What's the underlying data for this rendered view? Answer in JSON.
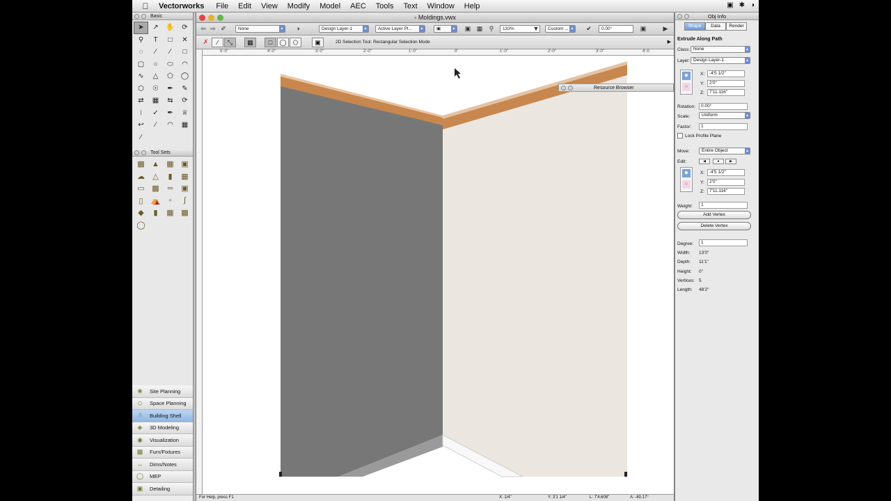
{
  "menubar": {
    "app": "Vectorworks",
    "items": [
      "File",
      "Edit",
      "View",
      "Modify",
      "Model",
      "AEC",
      "Tools",
      "Text",
      "Window",
      "Help"
    ]
  },
  "basic_palette": {
    "title": "Basic"
  },
  "toolsets_palette": {
    "title": "Tool Sets"
  },
  "workspaces": [
    {
      "label": "Site Planning",
      "icon": "leaf-icon"
    },
    {
      "label": "Space Planning",
      "icon": "space-icon"
    },
    {
      "label": "Building Shell",
      "icon": "shell-icon"
    },
    {
      "label": "3D Modeling",
      "icon": "cube-icon"
    },
    {
      "label": "Visualization",
      "icon": "bulb-icon"
    },
    {
      "label": "Furn/Fixtures",
      "icon": "chair-icon"
    },
    {
      "label": "Dims/Notes",
      "icon": "dims-icon"
    },
    {
      "label": "MEP",
      "icon": "mep-icon"
    },
    {
      "label": "Detailing",
      "icon": "detail-icon"
    }
  ],
  "active_workspace": "Building Shell",
  "document": {
    "title": "Moldings.vwx",
    "viewbar": {
      "class": "None",
      "layer": "Design Layer-1",
      "layer_options": "Active Layer Pl...",
      "zoom": "133%",
      "view": "Custom ...",
      "angle": "0.00°"
    },
    "mode_text": "2D Selection Tool: Rectangular Selection Mode",
    "ruler_marks": [
      "5'-0\"",
      "4'-0\"",
      "3'-0\"",
      "2'-0\"",
      "1'-0\"",
      "0\"",
      "1'-0\"",
      "2'-0\"",
      "3'-0\"",
      "4'-0"
    ],
    "status": {
      "help": "For Help, press F1",
      "x": "X: 1/4\"",
      "y": "Y: 3'1 1/4\"",
      "l": "L: 7'4.608\"",
      "a": "A: -80.17°"
    }
  },
  "resource_browser": {
    "title": "Resource Browser"
  },
  "obj_info": {
    "title": "Obj Info",
    "tabs": [
      "Shape",
      "Data",
      "Render"
    ],
    "object_type": "Extrude Along Path",
    "class_label": "Class:",
    "class_value": "None",
    "layer_label": "Layer:",
    "layer_value": "Design Layer-1",
    "x_label": "X:",
    "x_value": "-4'5 1/2\"",
    "y_label": "Y:",
    "y_value": "2'0\"",
    "z_label": "Z:",
    "z_value": "7'11.116\"",
    "rotation_label": "Rotation:",
    "rotation_value": "0.00°",
    "scale_label": "Scale:",
    "scale_value": "Uniform",
    "factor_label": "Factor:",
    "factor_value": "1",
    "lock_label": "Lock Profile Plane",
    "move_label": "Move:",
    "move_value": "Entire Object",
    "edit_label": "Edit:",
    "vx_label": "X:",
    "vx_value": "-4'5 1/2\"",
    "vy_label": "Y:",
    "vy_value": "2'0\"",
    "vz_label": "Z:",
    "vz_value": "7'11.116\"",
    "weight_label": "Weight:",
    "weight_value": "1",
    "add_vertex": "Add Vertex",
    "delete_vertex": "Delete Vertex",
    "degree_label": "Degree:",
    "degree_value": "1",
    "width_label": "Width:",
    "width_value": "13'0\"",
    "depth_label": "Depth:",
    "depth_value": "11'1\"",
    "height_label": "Height:",
    "height_value": "0\"",
    "vertices_label": "Vertices:",
    "vertices_value": "5",
    "length_label": "Length:",
    "length_value": "48'2\""
  },
  "colors": {
    "wall_left": "#757575",
    "wall_right": "#ebe7e0",
    "molding": "#c8874e",
    "highlight_tab": "#6c9ad8"
  }
}
